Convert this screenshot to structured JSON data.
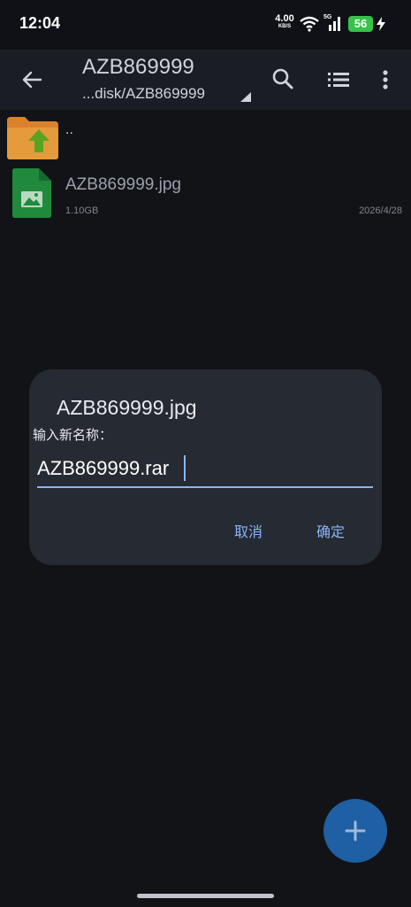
{
  "status": {
    "time": "12:04",
    "net_speed": "4.00",
    "net_unit": "KB/S",
    "network": "5G",
    "battery": "56"
  },
  "toolbar": {
    "title": "AZB869999",
    "path": "...disk/AZB869999"
  },
  "files": {
    "up_label": "..",
    "items": [
      {
        "name": "AZB869999.jpg",
        "size": "1.10GB",
        "date": "2026/4/28"
      }
    ]
  },
  "dialog": {
    "title": "AZB869999.jpg",
    "label": "输入新名称：",
    "input_value": "AZB869999.rar",
    "cancel": "取消",
    "confirm": "确定"
  },
  "colors": {
    "accent": "#8ab4f8",
    "fab": "#1f5fa3",
    "battery": "#37c24a"
  },
  "icons": [
    "back-arrow-icon",
    "search-icon",
    "list-view-icon",
    "more-vert-icon",
    "folder-up-icon",
    "image-file-icon",
    "add-icon"
  ]
}
